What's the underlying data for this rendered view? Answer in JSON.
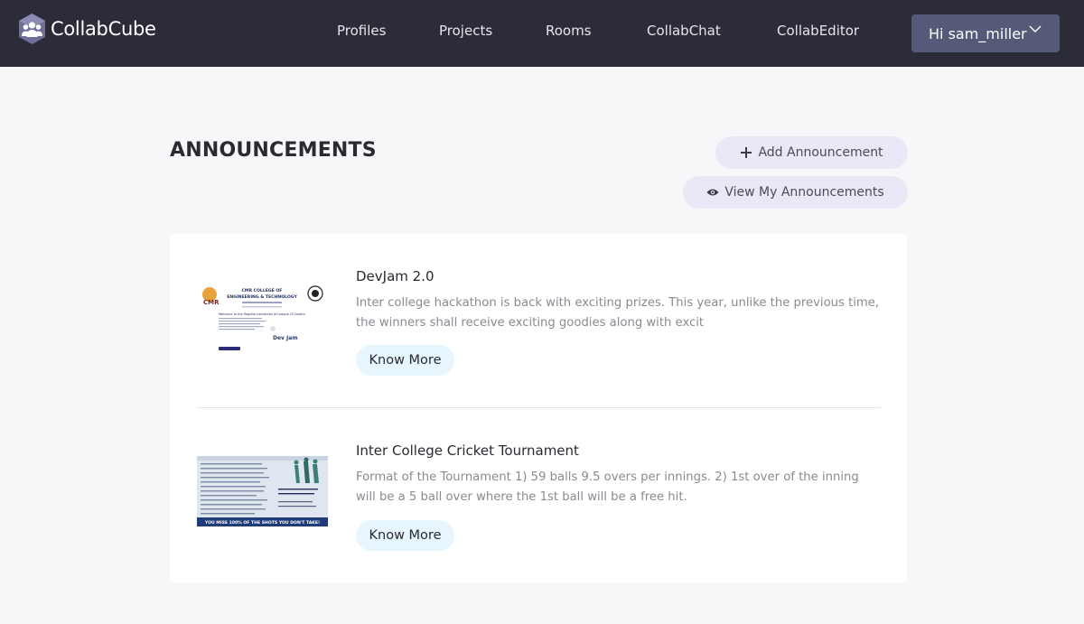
{
  "brand": {
    "name": "CollabCube",
    "logo_icon": "people-cube-icon"
  },
  "nav": {
    "links": [
      {
        "label": "Profiles"
      },
      {
        "label": "Projects"
      },
      {
        "label": "Rooms"
      },
      {
        "label": "CollabChat"
      },
      {
        "label": "CollabEditor"
      }
    ],
    "user_menu": {
      "label": "Hi sam_miller",
      "icon": "chevron-down-icon"
    }
  },
  "header": {
    "title": "ANNOUNCEMENTS",
    "add_label": "Add Announcement",
    "add_icon": "plus-icon",
    "view_label": "View My Announcements",
    "view_icon": "eye-icon"
  },
  "announcements": [
    {
      "title": "DevJam 2.0",
      "description": "Inter college hackathon is back with exciting prizes. This year, unlike the previous time, the winners shall receive exciting goodies along with excit",
      "button_label": "Know More",
      "image": {
        "line1": "CMR COLLEGE OF",
        "line2": "ENGINEERING & TECHNOLOGY",
        "heading": "Welcome to the flagship hackathon of League Of Coders",
        "logo_text": "Dev Jam"
      }
    },
    {
      "title": "Inter College Cricket Tournament",
      "description": "Format of the Tournament 1) 59 balls 9.5 overs per innings. 2) 1st over of the inning will be a 5 ball over where the 1st ball will be a free hit.",
      "button_label": "Know More",
      "image": {
        "banner": "YOU MISS 100% OF THE SHOTS YOU DON'T TAKE!"
      }
    }
  ],
  "colors": {
    "navbar": "#2c2c39",
    "user_button": "#545a78",
    "pill_button": "#e9e8f6",
    "know_more_button": "#e6f6fc",
    "page_background": "#f7f7f9"
  }
}
